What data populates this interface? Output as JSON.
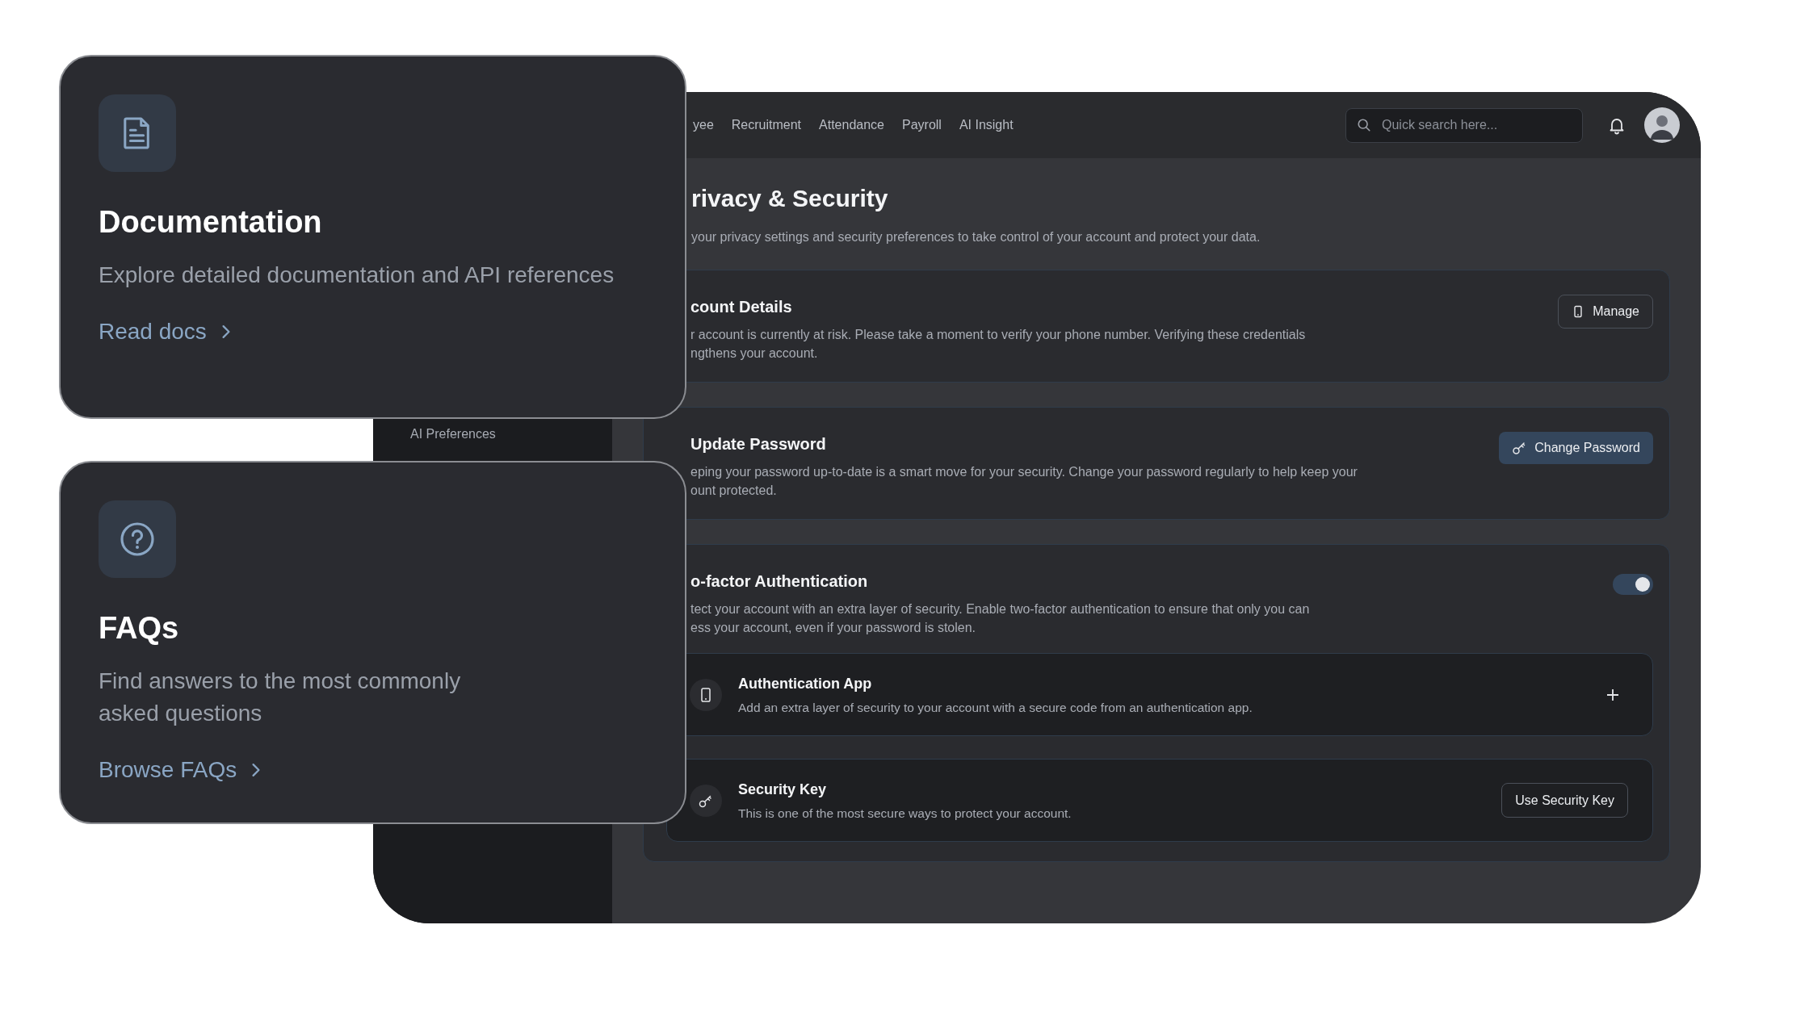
{
  "sidebar": {
    "items": [
      {
        "label": "AI Preferences"
      }
    ]
  },
  "nav": {
    "items": [
      "yee",
      "Recruitment",
      "Attendance",
      "Payroll",
      "AI Insight"
    ]
  },
  "search": {
    "placeholder": "Quick search here..."
  },
  "page": {
    "title": "rivacy & Security",
    "subtitle": "your privacy settings and security preferences to take control of your account and protect your data."
  },
  "sections": [
    {
      "kind": "manage",
      "title": "count Details",
      "lines": [
        "r account is currently at risk. Please take a moment to verify your phone number. Verifying these credentials",
        "ngthens your account."
      ],
      "button": "Manage"
    },
    {
      "kind": "password",
      "title": "Update Password",
      "lines": [
        "eping your password up-to-date is a smart move for your security. Change your password regularly to help keep your",
        "ount protected."
      ],
      "button": "Change Password"
    },
    {
      "kind": "toggle",
      "title": "o-factor Authentication",
      "lines": [
        "tect your account with an extra layer of security. Enable two-factor authentication to ensure that only you can",
        "ess your account, even if your password is stolen."
      ],
      "on": true,
      "methods": [
        {
          "kind": "app",
          "title": "Authentication App",
          "description": "Add an extra layer of security to your account with a secure code from an authentication app."
        },
        {
          "kind": "key",
          "title": "Security Key",
          "description": "This is one of the most secure ways to protect your account.",
          "button": "Use Security Key"
        }
      ]
    }
  ],
  "help_cards": [
    {
      "kind": "docs",
      "title": "Documentation",
      "description": "Explore detailed documentation and API references",
      "link": "Read docs"
    },
    {
      "kind": "faq",
      "title": "FAQs",
      "description": "Find answers to the most commonly asked questions",
      "link": "Browse FAQs"
    }
  ]
}
